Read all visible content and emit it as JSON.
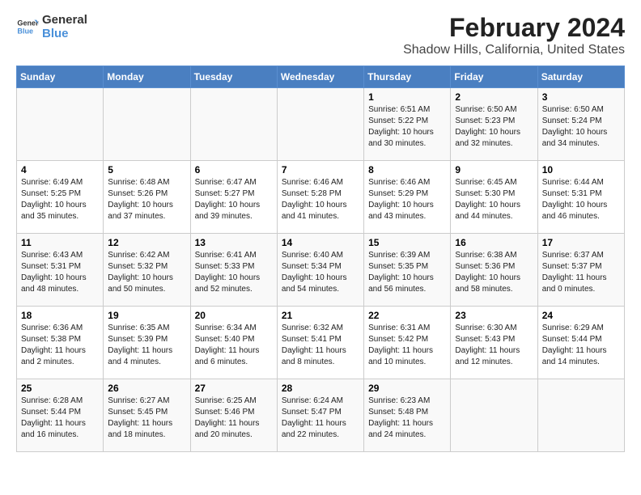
{
  "logo": {
    "line1": "General",
    "line2": "Blue"
  },
  "title": "February 2024",
  "subtitle": "Shadow Hills, California, United States",
  "days_of_week": [
    "Sunday",
    "Monday",
    "Tuesday",
    "Wednesday",
    "Thursday",
    "Friday",
    "Saturday"
  ],
  "weeks": [
    [
      {
        "day": "",
        "info": ""
      },
      {
        "day": "",
        "info": ""
      },
      {
        "day": "",
        "info": ""
      },
      {
        "day": "",
        "info": ""
      },
      {
        "day": "1",
        "info": "Sunrise: 6:51 AM\nSunset: 5:22 PM\nDaylight: 10 hours\nand 30 minutes."
      },
      {
        "day": "2",
        "info": "Sunrise: 6:50 AM\nSunset: 5:23 PM\nDaylight: 10 hours\nand 32 minutes."
      },
      {
        "day": "3",
        "info": "Sunrise: 6:50 AM\nSunset: 5:24 PM\nDaylight: 10 hours\nand 34 minutes."
      }
    ],
    [
      {
        "day": "4",
        "info": "Sunrise: 6:49 AM\nSunset: 5:25 PM\nDaylight: 10 hours\nand 35 minutes."
      },
      {
        "day": "5",
        "info": "Sunrise: 6:48 AM\nSunset: 5:26 PM\nDaylight: 10 hours\nand 37 minutes."
      },
      {
        "day": "6",
        "info": "Sunrise: 6:47 AM\nSunset: 5:27 PM\nDaylight: 10 hours\nand 39 minutes."
      },
      {
        "day": "7",
        "info": "Sunrise: 6:46 AM\nSunset: 5:28 PM\nDaylight: 10 hours\nand 41 minutes."
      },
      {
        "day": "8",
        "info": "Sunrise: 6:46 AM\nSunset: 5:29 PM\nDaylight: 10 hours\nand 43 minutes."
      },
      {
        "day": "9",
        "info": "Sunrise: 6:45 AM\nSunset: 5:30 PM\nDaylight: 10 hours\nand 44 minutes."
      },
      {
        "day": "10",
        "info": "Sunrise: 6:44 AM\nSunset: 5:31 PM\nDaylight: 10 hours\nand 46 minutes."
      }
    ],
    [
      {
        "day": "11",
        "info": "Sunrise: 6:43 AM\nSunset: 5:31 PM\nDaylight: 10 hours\nand 48 minutes."
      },
      {
        "day": "12",
        "info": "Sunrise: 6:42 AM\nSunset: 5:32 PM\nDaylight: 10 hours\nand 50 minutes."
      },
      {
        "day": "13",
        "info": "Sunrise: 6:41 AM\nSunset: 5:33 PM\nDaylight: 10 hours\nand 52 minutes."
      },
      {
        "day": "14",
        "info": "Sunrise: 6:40 AM\nSunset: 5:34 PM\nDaylight: 10 hours\nand 54 minutes."
      },
      {
        "day": "15",
        "info": "Sunrise: 6:39 AM\nSunset: 5:35 PM\nDaylight: 10 hours\nand 56 minutes."
      },
      {
        "day": "16",
        "info": "Sunrise: 6:38 AM\nSunset: 5:36 PM\nDaylight: 10 hours\nand 58 minutes."
      },
      {
        "day": "17",
        "info": "Sunrise: 6:37 AM\nSunset: 5:37 PM\nDaylight: 11 hours\nand 0 minutes."
      }
    ],
    [
      {
        "day": "18",
        "info": "Sunrise: 6:36 AM\nSunset: 5:38 PM\nDaylight: 11 hours\nand 2 minutes."
      },
      {
        "day": "19",
        "info": "Sunrise: 6:35 AM\nSunset: 5:39 PM\nDaylight: 11 hours\nand 4 minutes."
      },
      {
        "day": "20",
        "info": "Sunrise: 6:34 AM\nSunset: 5:40 PM\nDaylight: 11 hours\nand 6 minutes."
      },
      {
        "day": "21",
        "info": "Sunrise: 6:32 AM\nSunset: 5:41 PM\nDaylight: 11 hours\nand 8 minutes."
      },
      {
        "day": "22",
        "info": "Sunrise: 6:31 AM\nSunset: 5:42 PM\nDaylight: 11 hours\nand 10 minutes."
      },
      {
        "day": "23",
        "info": "Sunrise: 6:30 AM\nSunset: 5:43 PM\nDaylight: 11 hours\nand 12 minutes."
      },
      {
        "day": "24",
        "info": "Sunrise: 6:29 AM\nSunset: 5:44 PM\nDaylight: 11 hours\nand 14 minutes."
      }
    ],
    [
      {
        "day": "25",
        "info": "Sunrise: 6:28 AM\nSunset: 5:44 PM\nDaylight: 11 hours\nand 16 minutes."
      },
      {
        "day": "26",
        "info": "Sunrise: 6:27 AM\nSunset: 5:45 PM\nDaylight: 11 hours\nand 18 minutes."
      },
      {
        "day": "27",
        "info": "Sunrise: 6:25 AM\nSunset: 5:46 PM\nDaylight: 11 hours\nand 20 minutes."
      },
      {
        "day": "28",
        "info": "Sunrise: 6:24 AM\nSunset: 5:47 PM\nDaylight: 11 hours\nand 22 minutes."
      },
      {
        "day": "29",
        "info": "Sunrise: 6:23 AM\nSunset: 5:48 PM\nDaylight: 11 hours\nand 24 minutes."
      },
      {
        "day": "",
        "info": ""
      },
      {
        "day": "",
        "info": ""
      }
    ]
  ]
}
